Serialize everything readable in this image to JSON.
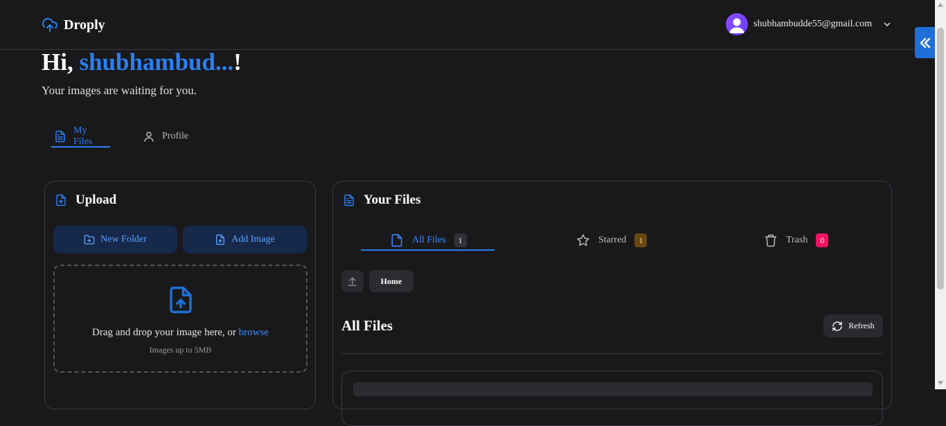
{
  "header": {
    "brand": "Droply",
    "user_email": "shubhambudde55@gmail.com",
    "icons": [
      "cloud-upload-icon",
      "avatar-user-icon",
      "chevron-down-icon",
      "double-chevron-left-icon"
    ]
  },
  "greeting": {
    "prefix": "Hi, ",
    "name": "shubhambud...",
    "suffix": "!",
    "subtitle": "Your images are waiting for you."
  },
  "main_tabs": [
    {
      "label": "My Files",
      "icon": "file-text-icon",
      "active": true
    },
    {
      "label": "Profile",
      "icon": "user-icon",
      "active": false
    }
  ],
  "upload": {
    "title": "Upload",
    "new_folder_label": "New Folder",
    "add_image_label": "Add Image",
    "dropzone_text": "Drag and drop your image here, or ",
    "browse_label": "browse",
    "dropzone_hint": "Images up to 5MB"
  },
  "files": {
    "title": "Your Files",
    "tabs": [
      {
        "label": "All Files",
        "count": "1",
        "icon": "file-icon",
        "active": true
      },
      {
        "label": "Starred",
        "count": "1",
        "icon": "star-icon",
        "active": false
      },
      {
        "label": "Trash",
        "count": "0",
        "icon": "trash-icon",
        "active": false
      }
    ],
    "breadcrumb_home": "Home",
    "heading": "All Files",
    "refresh_label": "Refresh"
  },
  "colors": {
    "background": "#19191c",
    "accent": "#2a7ff0",
    "starred_badge": "#6a4812",
    "trash_badge": "#f31260"
  }
}
